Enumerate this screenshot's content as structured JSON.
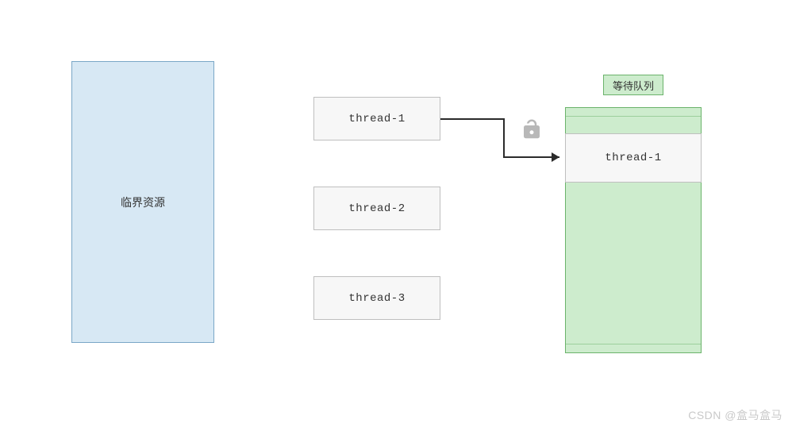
{
  "critical": {
    "label": "临界资源"
  },
  "threads": {
    "t1": "thread-1",
    "t2": "thread-2",
    "t3": "thread-3"
  },
  "queue": {
    "label": "等待队列",
    "slot1": "thread-1"
  },
  "icons": {
    "lock": "unlock-icon"
  },
  "watermark": "CSDN @盒马盒马"
}
